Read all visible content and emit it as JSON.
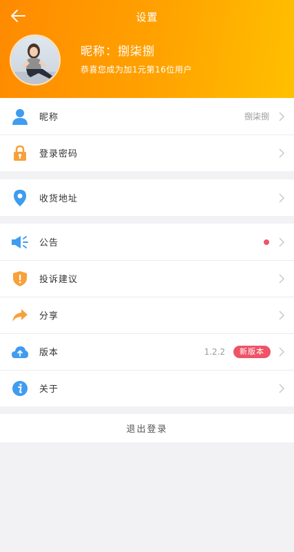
{
  "header": {
    "title": "设置",
    "nickname_line": "昵称：捌柒捌",
    "subtitle": "恭喜您成为加1元第16位用户"
  },
  "groups": {
    "account": [
      {
        "label": "昵称",
        "value": "捌柒捌",
        "icon": "user-icon"
      },
      {
        "label": "登录密码",
        "icon": "lock-icon"
      }
    ],
    "address": [
      {
        "label": "收货地址",
        "icon": "location-pin-icon"
      }
    ],
    "misc": [
      {
        "label": "公告",
        "icon": "megaphone-icon",
        "has_dot": true
      },
      {
        "label": "投诉建议",
        "icon": "shield-alert-icon"
      },
      {
        "label": "分享",
        "icon": "share-arrow-icon"
      },
      {
        "label": "版本",
        "value": "1.2.2",
        "badge": "新版本",
        "icon": "cloud-upload-icon"
      },
      {
        "label": "关于",
        "icon": "info-icon"
      }
    ]
  },
  "logout_label": "退出登录",
  "colors": {
    "header_gradient_start": "#ff8a00",
    "header_gradient_end": "#ffc000",
    "accent_blue": "#3f9cf0",
    "icon_orange": "#f7a13a",
    "badge_red": "#ee5368",
    "page_bg": "#f2f2f5"
  }
}
